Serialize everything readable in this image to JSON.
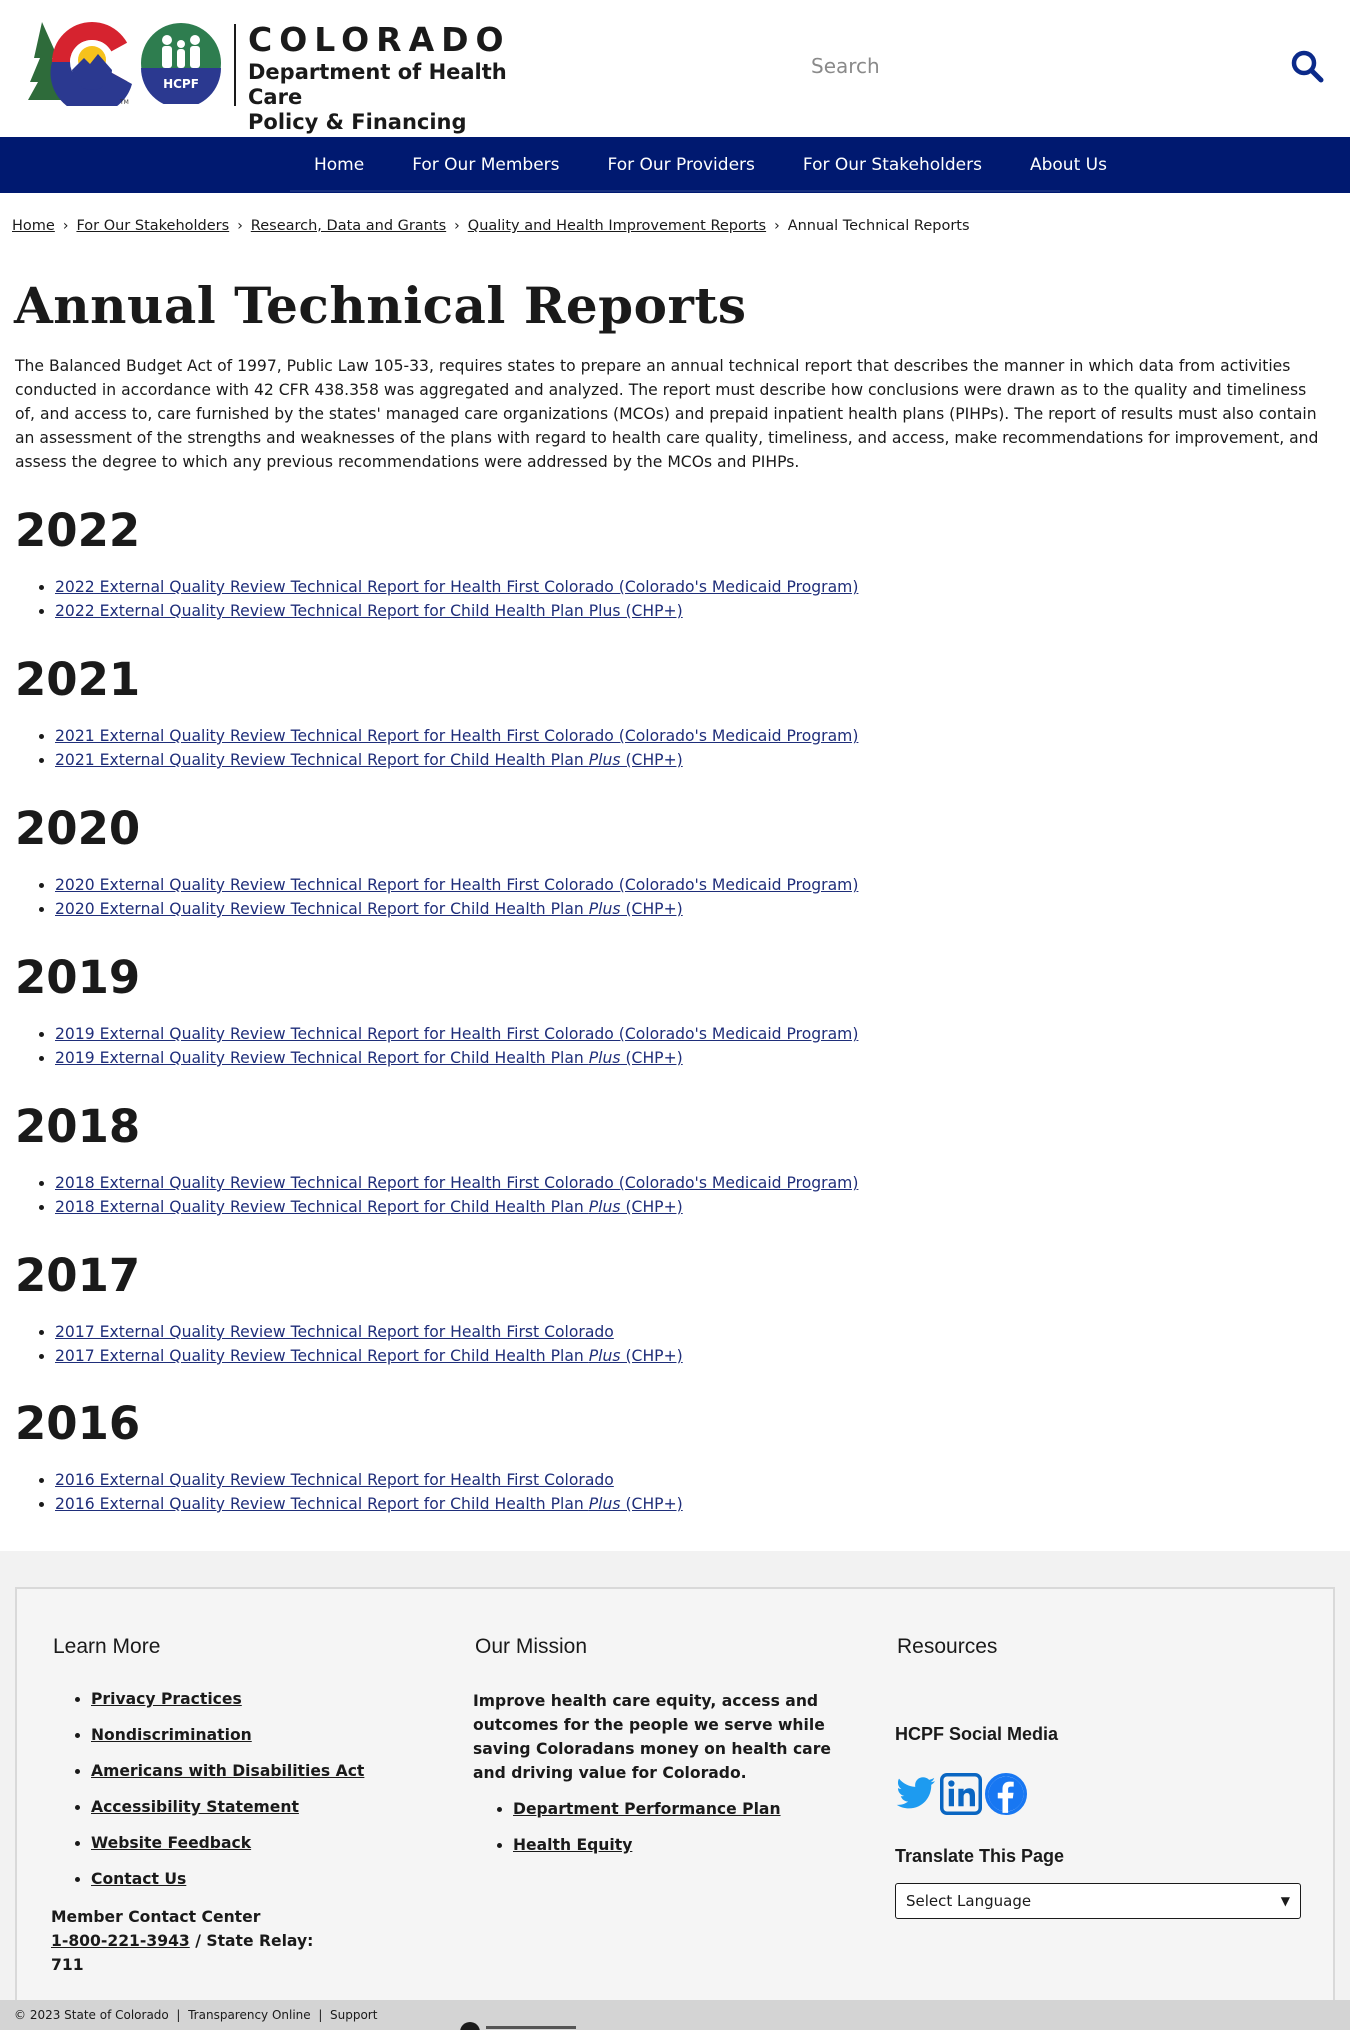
{
  "header": {
    "state_name": "COLORADO",
    "dept_line1": "Department of Health Care",
    "dept_line2": "Policy & Financing",
    "hcpf_badge": "HCPF",
    "search_placeholder": "Search",
    "icons": {
      "search": "search-icon"
    }
  },
  "nav": {
    "items": [
      "Home",
      "For Our Members",
      "For Our Providers",
      "For Our Stakeholders",
      "About Us"
    ],
    "background": "#001970"
  },
  "breadcrumb": {
    "links": [
      "Home",
      "For Our Stakeholders",
      "Research, Data and Grants",
      "Quality and Health Improvement Reports"
    ],
    "current": "Annual Technical Reports",
    "separator": "›"
  },
  "page": {
    "title": "Annual Technical Reports",
    "intro": "The Balanced Budget Act of 1997, Public Law 105-33, requires states to prepare an annual technical report that describes the manner in which data from activities conducted in accordance with 42 CFR 438.358 was aggregated and analyzed. The report must describe how conclusions were drawn as to the quality and timeliness of, and access to, care furnished by the states' managed care organizations (MCOs) and prepaid inpatient health plans (PIHPs). The report of results must also contain an assessment of the strengths and weaknesses of the plans with regard to health care quality, timeliness, and access, make recommendations for improvement, and assess the degree to which any previous recommendations were addressed by the MCOs and PIHPs."
  },
  "years": [
    {
      "year": "2022",
      "links": [
        {
          "pre": "2022 External Quality Review Technical Report for Health First Colorado (Colorado's Medicaid Program)",
          "em": "",
          "post": ""
        },
        {
          "pre": "2022 External Quality Review Technical Report for Child Health Plan Plus (CHP+)",
          "em": "",
          "post": ""
        }
      ]
    },
    {
      "year": "2021",
      "links": [
        {
          "pre": "2021 External Quality Review Technical Report for Health First Colorado (Colorado's Medicaid Program)",
          "em": "",
          "post": ""
        },
        {
          "pre": "2021 External Quality Review Technical Report for Child Health Plan ",
          "em": "Plus",
          "post": " (CHP+)"
        }
      ]
    },
    {
      "year": "2020",
      "links": [
        {
          "pre": "2020 External Quality Review Technical Report for Health First Colorado (Colorado's Medicaid Program)",
          "em": "",
          "post": ""
        },
        {
          "pre": "2020 External Quality Review Technical Report for Child Health Plan ",
          "em": "Plus",
          "post": " (CHP+)"
        }
      ]
    },
    {
      "year": "2019",
      "links": [
        {
          "pre": "2019 External Quality Review Technical Report for Health First Colorado (Colorado's Medicaid Program)",
          "em": "",
          "post": ""
        },
        {
          "pre": "2019 External Quality Review Technical Report for Child Health Plan ",
          "em": "Plus",
          "post": " (CHP+)"
        }
      ]
    },
    {
      "year": "2018",
      "links": [
        {
          "pre": "2018 External Quality Review Technical Report for Health First Colorado (Colorado's Medicaid Program)",
          "em": "",
          "post": ""
        },
        {
          "pre": "2018 External Quality Review Technical Report for Child Health Plan ",
          "em": "Plus",
          "post": " (CHP+)"
        }
      ]
    },
    {
      "year": "2017",
      "links": [
        {
          "pre": "2017 External Quality Review Technical Report for Health First Colorado",
          "em": "",
          "post": ""
        },
        {
          "pre": "2017 External Quality Review Technical Report for Child Health Plan ",
          "em": "Plus",
          "post": " (CHP+)"
        }
      ]
    },
    {
      "year": "2016",
      "links": [
        {
          "pre": "2016 External Quality Review Technical Report for Health First Colorado",
          "em": "",
          "post": ""
        },
        {
          "pre": "2016 External Quality Review Technical Report for Child Health Plan ",
          "em": "Plus",
          "post": " (CHP+)"
        }
      ]
    }
  ],
  "footer": {
    "learn_more": {
      "title": "Learn More",
      "links": [
        "Privacy Practices",
        "Nondiscrimination",
        "Americans with Disabilities Act",
        "Accessibility Statement",
        "Website Feedback",
        "Contact Us"
      ],
      "contact_label": "Member Contact Center",
      "phone": "1-800-221-3943",
      "relay": " / State Relay: 711"
    },
    "mission": {
      "title": "Our Mission",
      "text": "Improve health care equity, access and outcomes for the people we serve while saving Coloradans money on health care and driving value for Colorado.",
      "links": [
        "Department Performance Plan",
        "Health Equity"
      ]
    },
    "resources": {
      "title": "Resources",
      "social_title": "HCPF Social Media",
      "social_icons": [
        "twitter-icon",
        "linkedin-icon",
        "facebook-icon"
      ],
      "translate_title": "Translate This Page",
      "select_value": "Select Language"
    },
    "bottom": {
      "copyright": "© 2023 State of Colorado",
      "links": [
        "Transparency Online",
        "Support"
      ],
      "separator": "|"
    }
  },
  "colors": {
    "nav": "#001970",
    "link": "#1f2e7a",
    "search_icon": "#0b2a8a",
    "hcpf_green": "#2e7d4f",
    "twitter": "#1d9bf0",
    "linkedin": "#0a66c2",
    "facebook": "#1877f2"
  }
}
